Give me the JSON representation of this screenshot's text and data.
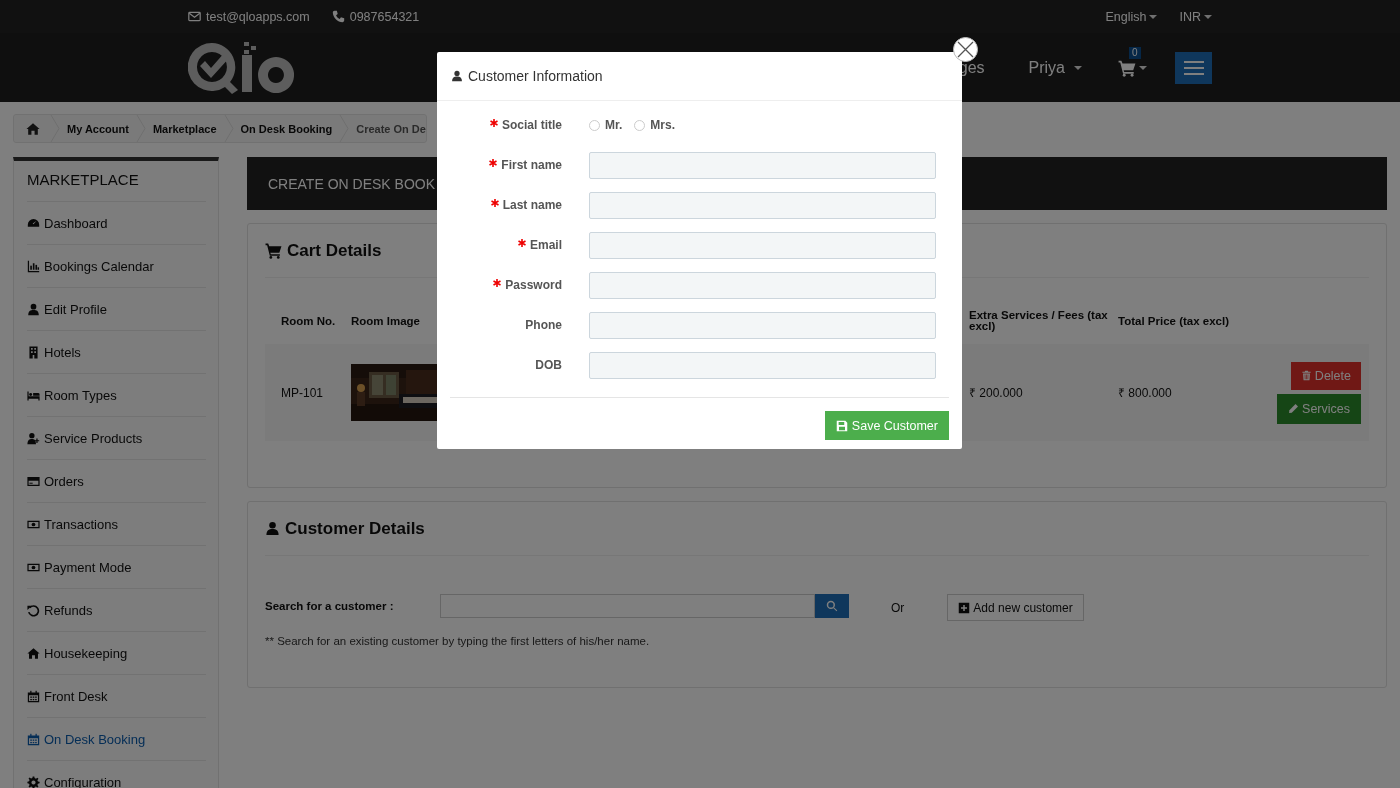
{
  "top_bar": {
    "email": "test@qloapps.com",
    "phone": "0987654321",
    "language": "English",
    "currency": "INR"
  },
  "header": {
    "nav_item": "ges",
    "user": "Priya",
    "cart_count": "0"
  },
  "breadcrumb": [
    {
      "label": "My Account",
      "current": false
    },
    {
      "label": "Marketplace",
      "current": false
    },
    {
      "label": "On Desk Booking",
      "current": false
    },
    {
      "label": "Create On De",
      "current": true
    }
  ],
  "sidebar": {
    "title": "MARKETPLACE",
    "items": [
      {
        "label": "Dashboard",
        "selected": false
      },
      {
        "label": "Bookings Calendar",
        "selected": false
      },
      {
        "label": "Edit Profile",
        "selected": false
      },
      {
        "label": "Hotels",
        "selected": false
      },
      {
        "label": "Room Types",
        "selected": false
      },
      {
        "label": "Service Products",
        "selected": false
      },
      {
        "label": "Orders",
        "selected": false
      },
      {
        "label": "Transactions",
        "selected": false
      },
      {
        "label": "Payment Mode",
        "selected": false
      },
      {
        "label": "Refunds",
        "selected": false
      },
      {
        "label": "Housekeeping",
        "selected": false
      },
      {
        "label": "Front Desk",
        "selected": false
      },
      {
        "label": "On Desk Booking",
        "selected": true
      },
      {
        "label": "Configuration",
        "selected": false
      }
    ]
  },
  "page_title": "CREATE ON DESK BOOK",
  "cart": {
    "title": "Cart Details",
    "columns": [
      "Room No.",
      "Room Image",
      "Extra Services / Fees (tax excl)",
      "Total Price (tax excl)"
    ],
    "rows": [
      {
        "room_no": "MP-101",
        "extra": "₹ 200.000",
        "total": "₹ 800.000",
        "actions": [
          {
            "label": "Delete",
            "kind": "danger"
          },
          {
            "label": "Services",
            "kind": "success"
          }
        ]
      }
    ]
  },
  "customer": {
    "title": "Customer Details",
    "search_label": "Search for a customer :",
    "or": "Or",
    "add_button": "Add new customer",
    "hint": "** Search for an existing customer by typing the first letters of his/her name."
  },
  "modal": {
    "title": "Customer Information",
    "social_title": {
      "label": "Social title",
      "required": true,
      "options": [
        {
          "label": "Mr.",
          "selected": false
        },
        {
          "label": "Mrs.",
          "selected": false
        }
      ]
    },
    "fields": [
      {
        "label": "First name",
        "required": true
      },
      {
        "label": "Last name",
        "required": true
      },
      {
        "label": "Email",
        "required": true
      },
      {
        "label": "Password",
        "required": true
      },
      {
        "label": "Phone",
        "required": false
      },
      {
        "label": "DOB",
        "required": false
      }
    ],
    "save_button": "Save Customer"
  }
}
